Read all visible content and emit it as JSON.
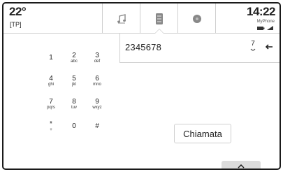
{
  "header": {
    "temperature": "22°",
    "radio_label": "[TP]",
    "time": "14:22",
    "phone_name": "MyPhone",
    "tabs": [
      {
        "icon": "music-note-icon"
      },
      {
        "icon": "phone-icon",
        "active": true
      },
      {
        "icon": "navigation-icon"
      }
    ]
  },
  "dialer": {
    "number": "2345678",
    "keys": [
      {
        "num": "1",
        "letters": ""
      },
      {
        "num": "2",
        "letters": "abc"
      },
      {
        "num": "3",
        "letters": "def"
      },
      {
        "num": "4",
        "letters": "ghi"
      },
      {
        "num": "5",
        "letters": "jkl"
      },
      {
        "num": "6",
        "letters": "mno"
      },
      {
        "num": "7",
        "letters": "pqrs"
      },
      {
        "num": "8",
        "letters": "tuv"
      },
      {
        "num": "9",
        "letters": "wxyz"
      },
      {
        "num": "*",
        "letters": "+"
      },
      {
        "num": "0",
        "letters": ""
      },
      {
        "num": "#",
        "letters": ""
      }
    ],
    "redial_num": "7",
    "call_label": "Chiamata"
  }
}
